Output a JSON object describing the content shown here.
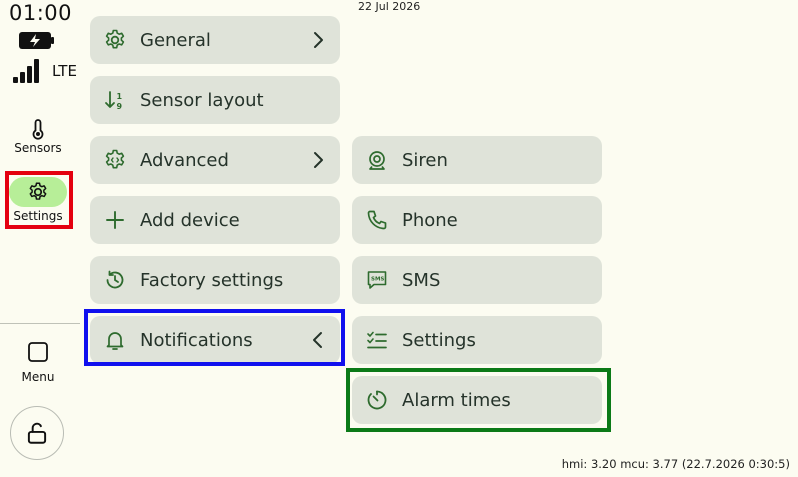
{
  "status": {
    "time": "01:00",
    "network": "LTE",
    "date": "22 Jul 2026"
  },
  "rail": {
    "sensors_label": "Sensors",
    "settings_label": "Settings",
    "menu_label": "Menu"
  },
  "menu": {
    "general": "General",
    "sensor_layout": "Sensor layout",
    "advanced": "Advanced",
    "add_device": "Add device",
    "factory_settings": "Factory settings",
    "notifications": "Notifications"
  },
  "notifications_submenu": {
    "siren": "Siren",
    "phone": "Phone",
    "sms": "SMS",
    "settings": "Settings",
    "alarm_times": "Alarm times"
  },
  "footer": {
    "version": "hmi: 3.20 mcu: 3.77 (22.7.2026 0:30:5)"
  },
  "colors": {
    "background": "#fcfcf1",
    "item_bg": "#dfe3d9",
    "accent_green": "#b7ee98",
    "icon_green": "#2e6b2e",
    "highlight_red": "#e4000f",
    "highlight_blue": "#1010ee",
    "highlight_green": "#0b7a17"
  },
  "icons": [
    "battery-charging-icon",
    "signal-bars-icon",
    "thermometer-icon",
    "gear-icon",
    "square-icon",
    "unlock-icon",
    "sort-icon",
    "code-gear-icon",
    "plus-icon",
    "restore-icon",
    "bell-icon",
    "chevron-right-icon",
    "chevron-left-icon",
    "siren-icon",
    "phone-icon",
    "sms-icon",
    "checklist-icon",
    "timer-icon"
  ]
}
